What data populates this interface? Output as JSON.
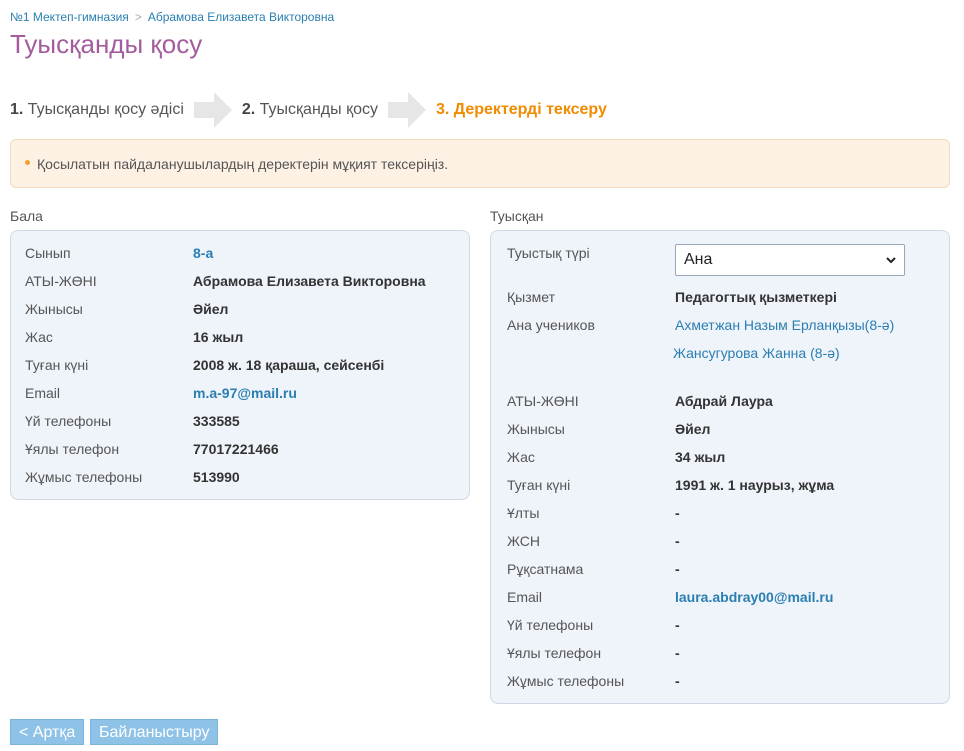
{
  "breadcrumb": {
    "items": [
      "№1 Мектеп-гимназия",
      "Абрамова Елизавета Викторовна"
    ]
  },
  "page_title": "Туысқанды қосу",
  "steps": [
    {
      "num": "1.",
      "label": "Туысқанды қосу әдісі",
      "active": false
    },
    {
      "num": "2.",
      "label": "Туысқанды қосу",
      "active": false
    },
    {
      "num": "3.",
      "label": "Деректерді тексеру",
      "active": true
    }
  ],
  "alert": {
    "text": "Қосылатын пайдаланушылардың деректерін мұқият тексеріңіз."
  },
  "child": {
    "title": "Бала",
    "rows": [
      {
        "label": "Сынып",
        "value": "8-а"
      },
      {
        "label": "АТЫ-ЖӨНІ",
        "value": "Абрамова Елизавета Викторовна"
      },
      {
        "label": "Жынысы",
        "value": "Әйел"
      },
      {
        "label": "Жас",
        "value": "16 жыл"
      },
      {
        "label": "Туған күні",
        "value": "2008 ж. 18 қараша, сейсенбі"
      },
      {
        "label": "Email",
        "value": "m.a-97@mail.ru"
      },
      {
        "label": "Үй телефоны",
        "value": "333585"
      },
      {
        "label": "Ұялы телефон",
        "value": "77017221466"
      },
      {
        "label": "Жұмыс телефоны",
        "value": "513990"
      }
    ]
  },
  "relative": {
    "title": "Туысқан",
    "relation_label": "Туыстық түрі",
    "relation_selected": "Ана",
    "position_label": "Қызмет",
    "position_value": "Педагогтық қызметкері",
    "students_label": "Ана учеников",
    "students": [
      {
        "name": "Ахметжан Назым Ерланқызы",
        "class": "(8-ә)"
      },
      {
        "name": "Жансугурова Жанна",
        "class": "(8-ә)"
      }
    ],
    "rows": [
      {
        "label": "АТЫ-ЖӨНІ",
        "value": "Абдрай Лаура"
      },
      {
        "label": "Жынысы",
        "value": "Әйел"
      },
      {
        "label": "Жас",
        "value": "34 жыл"
      },
      {
        "label": "Туған күні",
        "value": "1991 ж. 1 наурыз, жұма"
      },
      {
        "label": "Ұлты",
        "value": "-"
      },
      {
        "label": "ЖСН",
        "value": "-"
      },
      {
        "label": "Рұқсатнама",
        "value": "-"
      },
      {
        "label": "Email",
        "value": "laura.abdray00@mail.ru"
      },
      {
        "label": "Үй телефоны",
        "value": "-"
      },
      {
        "label": "Ұялы телефон",
        "value": "-"
      },
      {
        "label": "Жұмыс телефоны",
        "value": "-"
      }
    ]
  },
  "buttons": {
    "back": "< Артқа",
    "link": "Байланыстыру"
  },
  "colors": {
    "title": "#a35c9d",
    "active_step": "#f08c00",
    "link": "#2a7fb0",
    "panel_bg": "#eff3fa",
    "alert_bg": "#fcf1e3",
    "button": "#8ec2e6"
  },
  "icons": [
    "step-arrow-icon",
    "chevron-down-icon"
  ]
}
